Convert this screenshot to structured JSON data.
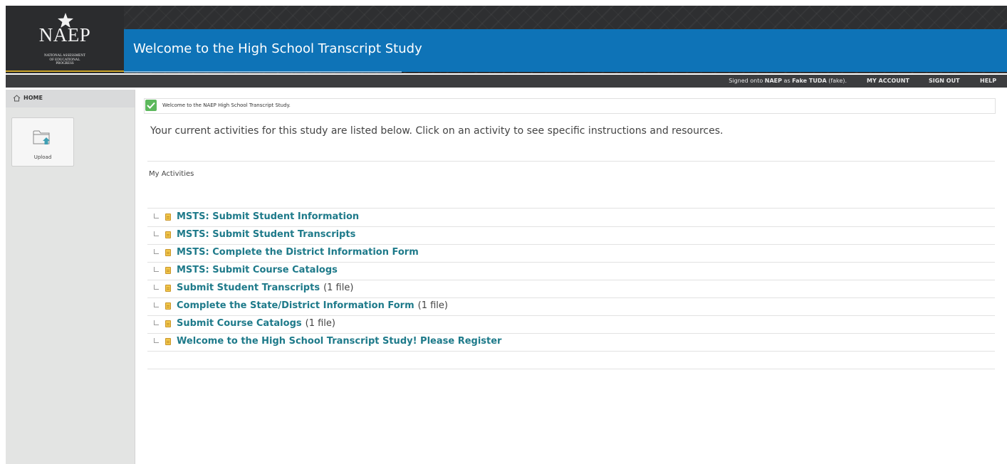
{
  "header": {
    "logo": {
      "text": "NAEP",
      "subtitle": "NATIONAL ASSESSMENT\nOF EDUCATIONAL\nPROGRESS"
    },
    "title": "Welcome to the High School Transcript Study"
  },
  "topnav": {
    "signed_prefix": "Signed onto ",
    "signed_system": "NAEP",
    "signed_middle": " as ",
    "signed_user": "Fake TUDA",
    "signed_suffix": " (fake).",
    "my_account": "MY ACCOUNT",
    "sign_out": "SIGN OUT",
    "help": "HELP"
  },
  "sidebar": {
    "home": "HOME",
    "upload": "Upload"
  },
  "alert": {
    "text": "Welcome to the NAEP High School Transcript Study."
  },
  "main": {
    "intro": "Your current activities for this study are listed below. Click on an activity to see specific instructions and resources.",
    "section_heading": "My Activities",
    "activities": [
      {
        "title": "MSTS: Submit Student Information",
        "count": ""
      },
      {
        "title": "MSTS: Submit Student Transcripts",
        "count": ""
      },
      {
        "title": "MSTS: Complete the District Information Form",
        "count": ""
      },
      {
        "title": "MSTS: Submit Course Catalogs",
        "count": ""
      },
      {
        "title": "Submit Student Transcripts",
        "count": "(1 file)"
      },
      {
        "title": "Complete the State/District Information Form",
        "count": "(1 file)"
      },
      {
        "title": "Submit Course Catalogs",
        "count": "(1 file)"
      },
      {
        "title": "Welcome to the High School Transcript Study! Please Register",
        "count": ""
      }
    ]
  },
  "colors": {
    "banner": "#0e73b7",
    "header_dark": "#2e2f31",
    "link": "#1e7a8a",
    "success": "#5cb85c"
  }
}
